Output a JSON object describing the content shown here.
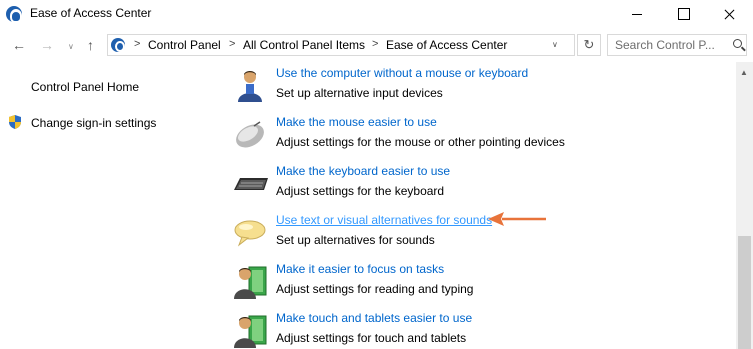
{
  "window": {
    "title": "Ease of Access Center",
    "icon": "ease-of-access-icon"
  },
  "navigation": {
    "breadcrumbs": [
      "Control Panel",
      "All Control Panel Items",
      "Ease of Access Center"
    ],
    "search_placeholder": "Search Control P..."
  },
  "sidebar": {
    "items": [
      {
        "label": "Control Panel Home"
      },
      {
        "label": "Change sign-in settings",
        "icon": "shield-icon"
      }
    ]
  },
  "tasks": [
    {
      "title": "Use the computer without a mouse or keyboard",
      "description": "Set up alternative input devices",
      "icon": "person-icon"
    },
    {
      "title": "Make the mouse easier to use",
      "description": "Adjust settings for the mouse or other pointing devices",
      "icon": "mouse-icon"
    },
    {
      "title": "Make the keyboard easier to use",
      "description": "Adjust settings for the keyboard",
      "icon": "keyboard-icon"
    },
    {
      "title": "Use text or visual alternatives for sounds",
      "description": "Set up alternatives for sounds",
      "icon": "speech-bubble-icon",
      "hovered": true
    },
    {
      "title": "Make it easier to focus on tasks",
      "description": "Adjust settings for reading and typing",
      "icon": "focus-person-icon"
    },
    {
      "title": "Make touch and tablets easier to use",
      "description": "Adjust settings for touch and tablets",
      "icon": "touch-person-icon"
    }
  ],
  "colors": {
    "link": "#0066cc",
    "link_hover": "#3399ff",
    "annotation_arrow": "#e8733a"
  }
}
